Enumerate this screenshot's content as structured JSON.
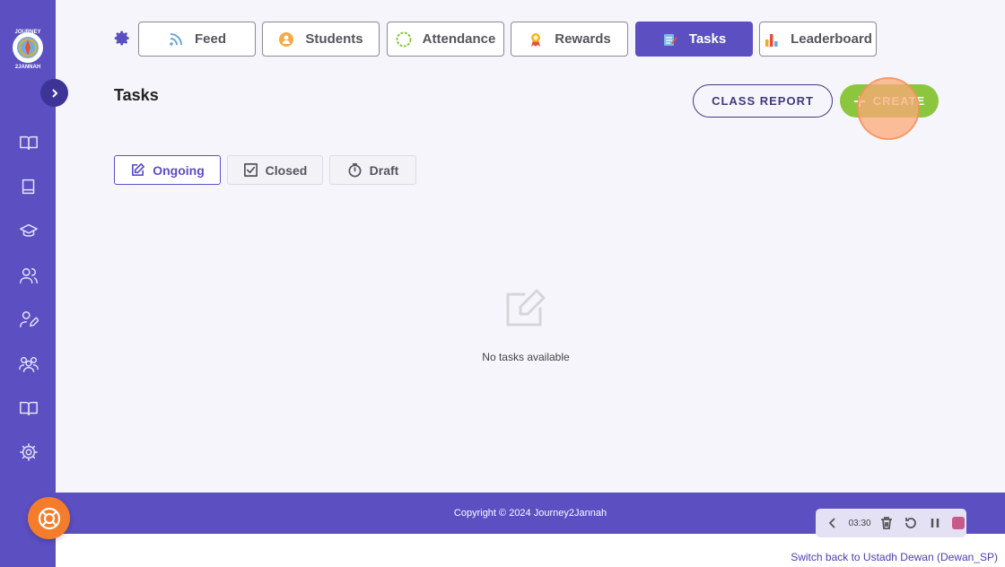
{
  "logo": {
    "line1": "JOURNEY",
    "line2": "2JANNAH"
  },
  "nav": {
    "tabs": [
      {
        "label": "Feed",
        "icon": "rss-icon"
      },
      {
        "label": "Students",
        "icon": "student-icon"
      },
      {
        "label": "Attendance",
        "icon": "attendance-icon"
      },
      {
        "label": "Rewards",
        "icon": "award-icon"
      },
      {
        "label": "Tasks",
        "icon": "tasks-icon",
        "active": true
      },
      {
        "label": "Leaderboard",
        "icon": "bar-chart-icon"
      }
    ]
  },
  "page": {
    "title": "Tasks",
    "class_report_label": "CLASS REPORT",
    "create_label": "CREATE"
  },
  "subtabs": [
    {
      "label": "Ongoing",
      "active": true
    },
    {
      "label": "Closed"
    },
    {
      "label": "Draft"
    }
  ],
  "empty_state": {
    "text": "No tasks available"
  },
  "footer": {
    "copyright": "Copyright © 2024  Journey2Jannah"
  },
  "recorder": {
    "time": "03:30"
  },
  "switch_back": {
    "label": "Switch back to Ustadh Dewan (Dewan_SP)"
  },
  "colors": {
    "primary": "#5b4fc2",
    "accent_green": "#8cc63f",
    "help_orange": "#f57c2a"
  }
}
